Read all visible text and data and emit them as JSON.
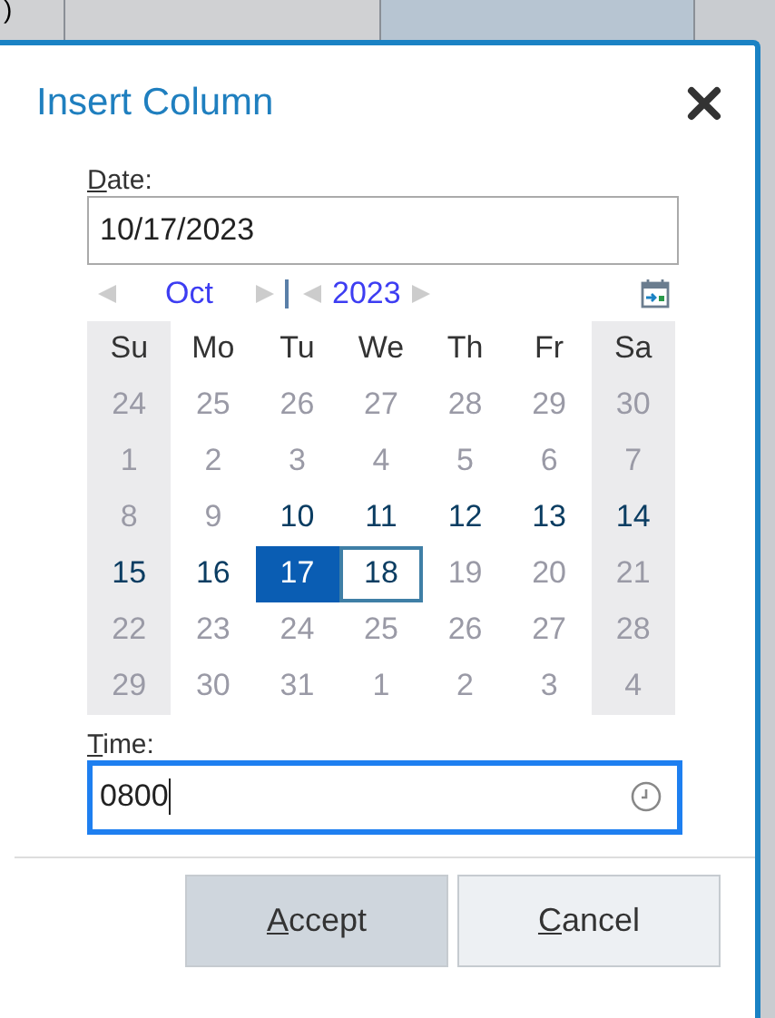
{
  "background_table": {
    "cells": [
      {
        "text": ")",
        "highlighted": false
      },
      {
        "text": "",
        "highlighted": false
      },
      {
        "text": "",
        "highlighted": true
      }
    ]
  },
  "dialog": {
    "title": "Insert Column",
    "date": {
      "label": "Date:",
      "underline_first": true,
      "value": "10/17/2023"
    },
    "calendar": {
      "month": "Oct",
      "year": "2023",
      "weekdays": [
        {
          "text": "Su",
          "weekend": true
        },
        {
          "text": "Mo",
          "weekend": false
        },
        {
          "text": "Tu",
          "weekend": false
        },
        {
          "text": "We",
          "weekend": false
        },
        {
          "text": "Th",
          "weekend": false
        },
        {
          "text": "Fr",
          "weekend": false
        },
        {
          "text": "Sa",
          "weekend": true
        }
      ],
      "weeks": [
        [
          {
            "text": "24",
            "enabled": false,
            "selected": false,
            "focused": false
          },
          {
            "text": "25",
            "enabled": false,
            "selected": false,
            "focused": false
          },
          {
            "text": "26",
            "enabled": false,
            "selected": false,
            "focused": false
          },
          {
            "text": "27",
            "enabled": false,
            "selected": false,
            "focused": false
          },
          {
            "text": "28",
            "enabled": false,
            "selected": false,
            "focused": false
          },
          {
            "text": "29",
            "enabled": false,
            "selected": false,
            "focused": false
          },
          {
            "text": "30",
            "enabled": false,
            "selected": false,
            "focused": false
          }
        ],
        [
          {
            "text": "1",
            "enabled": false,
            "selected": false,
            "focused": false
          },
          {
            "text": "2",
            "enabled": false,
            "selected": false,
            "focused": false
          },
          {
            "text": "3",
            "enabled": false,
            "selected": false,
            "focused": false
          },
          {
            "text": "4",
            "enabled": false,
            "selected": false,
            "focused": false
          },
          {
            "text": "5",
            "enabled": false,
            "selected": false,
            "focused": false
          },
          {
            "text": "6",
            "enabled": false,
            "selected": false,
            "focused": false
          },
          {
            "text": "7",
            "enabled": false,
            "selected": false,
            "focused": false
          }
        ],
        [
          {
            "text": "8",
            "enabled": false,
            "selected": false,
            "focused": false
          },
          {
            "text": "9",
            "enabled": false,
            "selected": false,
            "focused": false
          },
          {
            "text": "10",
            "enabled": true,
            "selected": false,
            "focused": false
          },
          {
            "text": "11",
            "enabled": true,
            "selected": false,
            "focused": false
          },
          {
            "text": "12",
            "enabled": true,
            "selected": false,
            "focused": false
          },
          {
            "text": "13",
            "enabled": true,
            "selected": false,
            "focused": false
          },
          {
            "text": "14",
            "enabled": true,
            "selected": false,
            "focused": false
          }
        ],
        [
          {
            "text": "15",
            "enabled": true,
            "selected": false,
            "focused": false
          },
          {
            "text": "16",
            "enabled": true,
            "selected": false,
            "focused": false
          },
          {
            "text": "17",
            "enabled": true,
            "selected": true,
            "focused": false
          },
          {
            "text": "18",
            "enabled": true,
            "selected": false,
            "focused": true
          },
          {
            "text": "19",
            "enabled": false,
            "selected": false,
            "focused": false
          },
          {
            "text": "20",
            "enabled": false,
            "selected": false,
            "focused": false
          },
          {
            "text": "21",
            "enabled": false,
            "selected": false,
            "focused": false
          }
        ],
        [
          {
            "text": "22",
            "enabled": false,
            "selected": false,
            "focused": false
          },
          {
            "text": "23",
            "enabled": false,
            "selected": false,
            "focused": false
          },
          {
            "text": "24",
            "enabled": false,
            "selected": false,
            "focused": false
          },
          {
            "text": "25",
            "enabled": false,
            "selected": false,
            "focused": false
          },
          {
            "text": "26",
            "enabled": false,
            "selected": false,
            "focused": false
          },
          {
            "text": "27",
            "enabled": false,
            "selected": false,
            "focused": false
          },
          {
            "text": "28",
            "enabled": false,
            "selected": false,
            "focused": false
          }
        ],
        [
          {
            "text": "29",
            "enabled": false,
            "selected": false,
            "focused": false
          },
          {
            "text": "30",
            "enabled": false,
            "selected": false,
            "focused": false
          },
          {
            "text": "31",
            "enabled": false,
            "selected": false,
            "focused": false
          },
          {
            "text": "1",
            "enabled": false,
            "selected": false,
            "focused": false
          },
          {
            "text": "2",
            "enabled": false,
            "selected": false,
            "focused": false
          },
          {
            "text": "3",
            "enabled": false,
            "selected": false,
            "focused": false
          },
          {
            "text": "4",
            "enabled": false,
            "selected": false,
            "focused": false
          }
        ]
      ]
    },
    "time": {
      "label": "Time:",
      "underline_first": true,
      "value": "0800",
      "focused": true
    },
    "buttons": [
      {
        "label": "Accept",
        "underline_first": true,
        "kind": "primary"
      },
      {
        "label": "Cancel",
        "underline_first": true,
        "kind": "secondary"
      }
    ]
  }
}
